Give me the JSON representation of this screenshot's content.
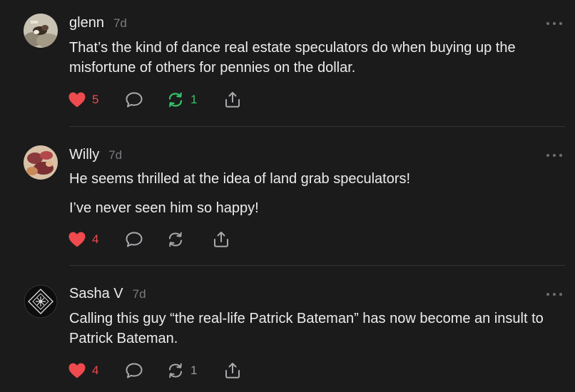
{
  "colors": {
    "background": "#1b1b1c",
    "text": "#ececec",
    "muted": "#7c7c80",
    "like": "#ef4a4d",
    "restack_active": "#35c46a",
    "icon": "#a9a9ad"
  },
  "comments": [
    {
      "author": "glenn",
      "age": "7d",
      "paragraphs": [
        "That’s the kind of dance real estate speculators do when buying up the misfortune of others for pennies on the dollar."
      ],
      "likes": "5",
      "restacks": "1",
      "restack_active": true,
      "icons": [
        "heart-icon",
        "comment-bubble-icon",
        "restack-icon",
        "share-icon"
      ]
    },
    {
      "author": "Willy",
      "age": "7d",
      "paragraphs": [
        "He seems thrilled at the idea of land grab speculators!",
        "I’ve never seen him so happy!"
      ],
      "likes": "4",
      "restacks": "",
      "restack_active": false,
      "icons": [
        "heart-icon",
        "comment-bubble-icon",
        "restack-icon",
        "share-icon"
      ]
    },
    {
      "author": "Sasha V",
      "age": "7d",
      "paragraphs": [
        "Calling this guy “the real-life Patrick Bateman” has now become an insult to Patrick Bateman."
      ],
      "likes": "4",
      "restacks": "1",
      "restack_active": false,
      "icons": [
        "heart-icon",
        "comment-bubble-icon",
        "restack-icon",
        "share-icon"
      ]
    }
  ]
}
